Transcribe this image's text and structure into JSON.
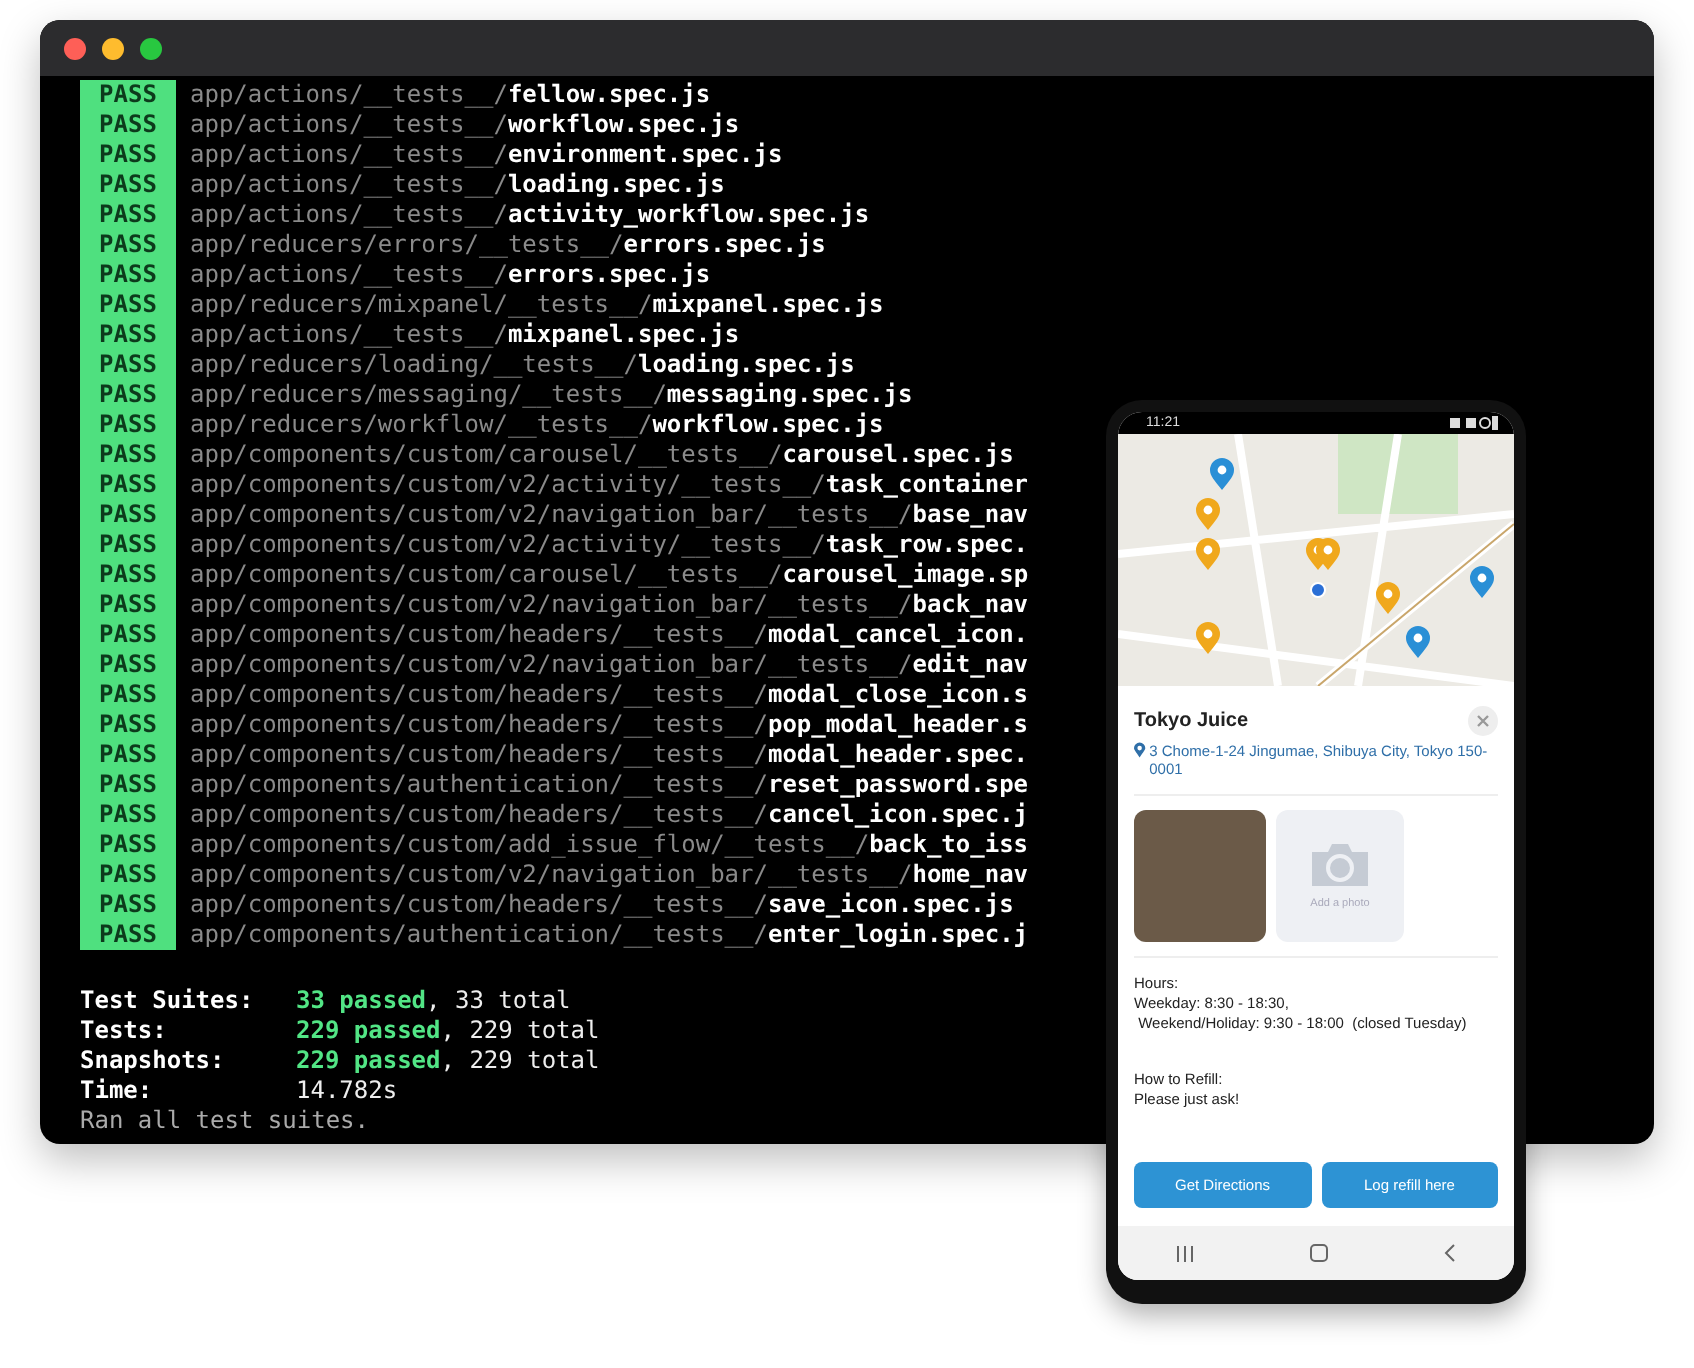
{
  "terminal": {
    "results": [
      {
        "status": "PASS",
        "path": "app/actions/__tests__/**fellow.spec.js**"
      },
      {
        "status": "PASS",
        "path": "app/actions/__tests__/**workflow.spec.js**"
      },
      {
        "status": "PASS",
        "path": "app/actions/__tests__/**environment.spec.js**"
      },
      {
        "status": "PASS",
        "path": "app/actions/__tests__/**loading.spec.js**"
      },
      {
        "status": "PASS",
        "path": "app/actions/__tests__/**activity_workflow.spec.js**"
      },
      {
        "status": "PASS",
        "path": "app/reducers/errors/__tests__/**errors.spec.js**"
      },
      {
        "status": "PASS",
        "path": "app/actions/__tests__/**errors.spec.js**"
      },
      {
        "status": "PASS",
        "path": "app/reducers/mixpanel/__tests__/**mixpanel.spec.js**"
      },
      {
        "status": "PASS",
        "path": "app/actions/__tests__/**mixpanel.spec.js**"
      },
      {
        "status": "PASS",
        "path": "app/reducers/loading/__tests__/**loading.spec.js**"
      },
      {
        "status": "PASS",
        "path": "app/reducers/messaging/__tests__/**messaging.spec.js**"
      },
      {
        "status": "PASS",
        "path": "app/reducers/workflow/__tests__/**workflow.spec.js**"
      },
      {
        "status": "PASS",
        "path": "app/components/custom/carousel/__tests__/**carousel.spec.js**"
      },
      {
        "status": "PASS",
        "path": "app/components/custom/v2/activity/__tests__/**task_container**"
      },
      {
        "status": "PASS",
        "path": "app/components/custom/v2/navigation_bar/__tests__/**base_nav**"
      },
      {
        "status": "PASS",
        "path": "app/components/custom/v2/activity/__tests__/**task_row.spec.**"
      },
      {
        "status": "PASS",
        "path": "app/components/custom/carousel/__tests__/**carousel_image.sp**"
      },
      {
        "status": "PASS",
        "path": "app/components/custom/v2/navigation_bar/__tests__/**back_nav**"
      },
      {
        "status": "PASS",
        "path": "app/components/custom/headers/__tests__/**modal_cancel_icon.**"
      },
      {
        "status": "PASS",
        "path": "app/components/custom/v2/navigation_bar/__tests__/**edit_nav**"
      },
      {
        "status": "PASS",
        "path": "app/components/custom/headers/__tests__/**modal_close_icon.s**"
      },
      {
        "status": "PASS",
        "path": "app/components/custom/headers/__tests__/**pop_modal_header.s**"
      },
      {
        "status": "PASS",
        "path": "app/components/custom/headers/__tests__/**modal_header.spec.**"
      },
      {
        "status": "PASS",
        "path": "app/components/authentication/__tests__/**reset_password.spe**"
      },
      {
        "status": "PASS",
        "path": "app/components/custom/headers/__tests__/**cancel_icon.spec.j**"
      },
      {
        "status": "PASS",
        "path": "app/components/custom/add_issue_flow/__tests__/**back_to_iss**"
      },
      {
        "status": "PASS",
        "path": "app/components/custom/v2/navigation_bar/__tests__/**home_nav**"
      },
      {
        "status": "PASS",
        "path": "app/components/custom/headers/__tests__/**save_icon.spec.js**"
      },
      {
        "status": "PASS",
        "path": "app/components/authentication/__tests__/**enter_login.spec.j**"
      }
    ],
    "summary": [
      {
        "label": "Test Suites:",
        "value": "**33 passed**, 33 total"
      },
      {
        "label": "Tests:",
        "value": "**229 passed**, 229 total"
      },
      {
        "label": "Snapshots:",
        "value": "**229 passed**, 229 total"
      },
      {
        "label": "Time:",
        "value": "14.782s"
      }
    ],
    "footer": "Ran all test suites."
  },
  "phone": {
    "status_bar": {
      "time": "11:21"
    },
    "place": {
      "name": "Tokyo Juice",
      "address": "3 Chome-1-24 Jingumae, Shibuya City, Tokyo 150-0001"
    },
    "add_photo": "Add a photo",
    "hours": [
      "Hours:",
      "Weekday: 8:30 - 18:30,",
      " Weekend/Holiday: 9:30 - 18:00  (closed Tuesday)"
    ],
    "refill": [
      "How to Refill:",
      "Please just ask!"
    ],
    "buttons": [
      "Get Directions",
      "Log refill here"
    ]
  }
}
